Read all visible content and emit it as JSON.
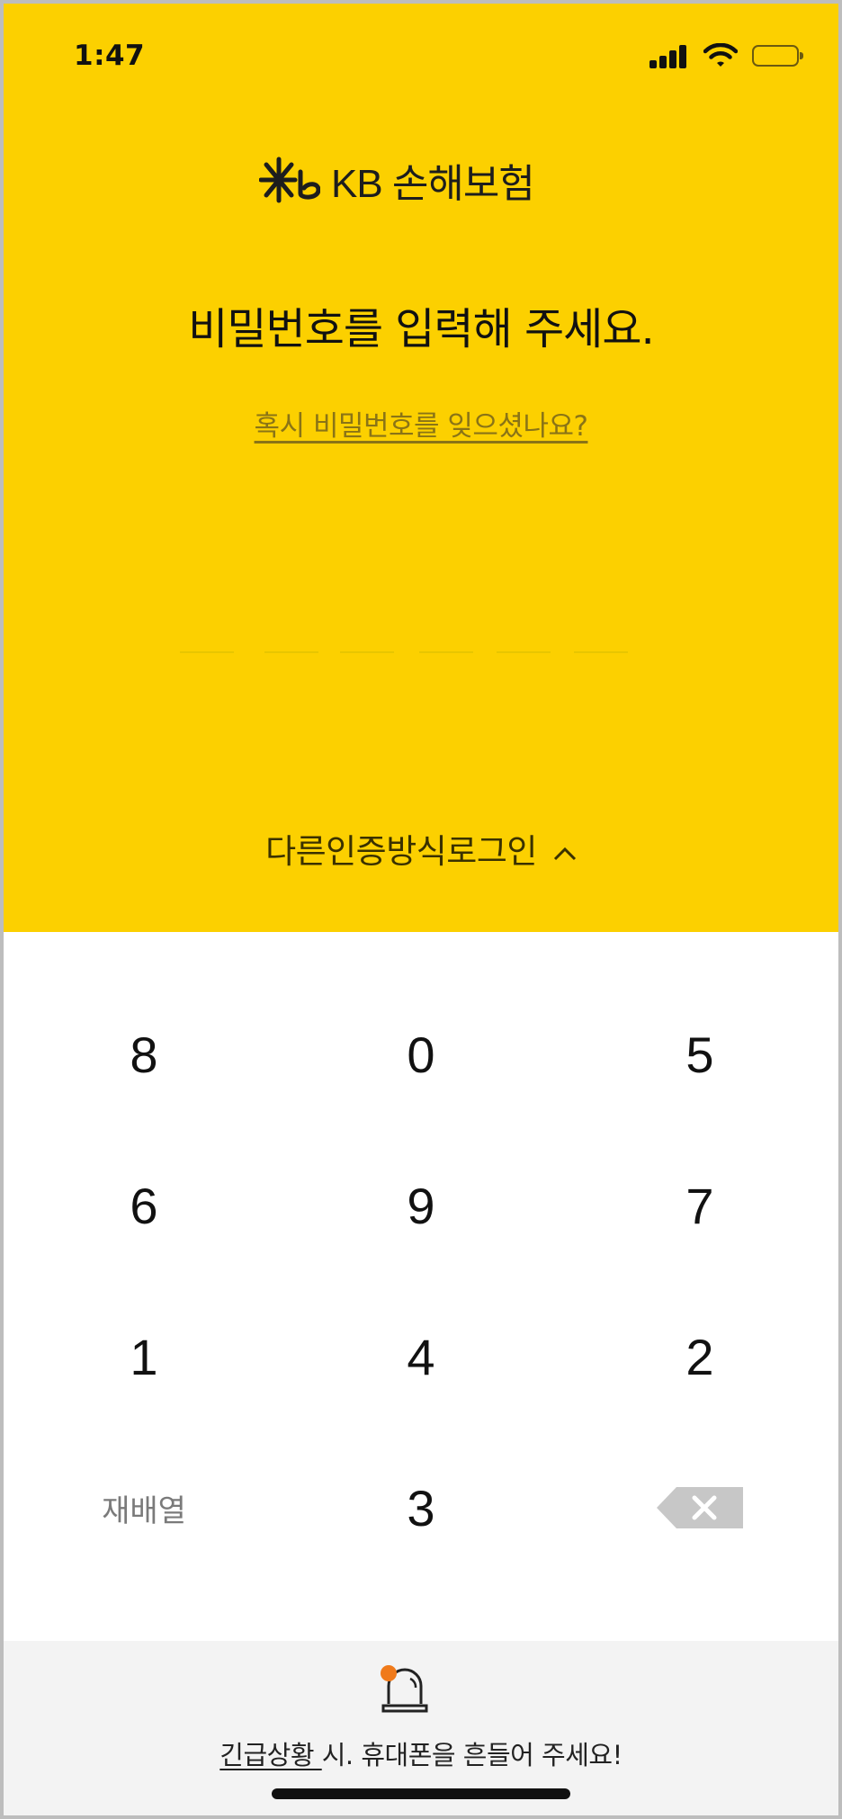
{
  "status_bar": {
    "time": "1:47"
  },
  "logo": {
    "text": "KB 손해보험"
  },
  "title": "비밀번호를 입력해 주세요.",
  "forgot_link": "혹시 비밀번호를 잊으셨나요?",
  "pin": {
    "length": 6
  },
  "other_login": {
    "label": "다른인증방식로그인"
  },
  "keypad": {
    "rows": [
      [
        "8",
        "0",
        "5"
      ],
      [
        "6",
        "9",
        "7"
      ],
      [
        "1",
        "4",
        "2"
      ]
    ],
    "shuffle_label": "재배열",
    "last_digit": "3"
  },
  "emergency": {
    "link": "긴급상황 ",
    "text": "시. 휴대폰을 흔들어 주세요!"
  },
  "colors": {
    "brand_yellow": "#FCD000",
    "backspace_gray": "#c7c7c7",
    "alarm_orange": "#F07A1A"
  }
}
